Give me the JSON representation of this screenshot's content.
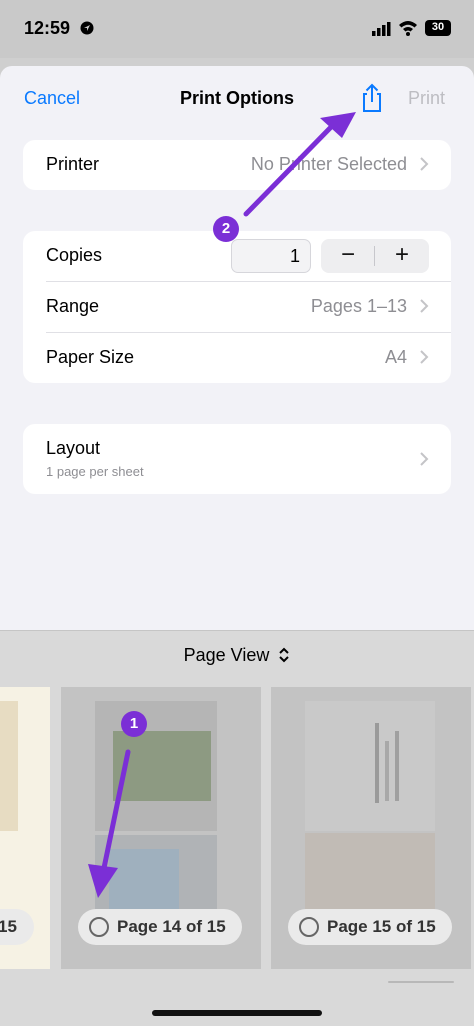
{
  "status": {
    "time": "12:59",
    "battery": "30"
  },
  "nav": {
    "cancel": "Cancel",
    "title": "Print Options",
    "print": "Print",
    "share_icon": "share-icon"
  },
  "printer": {
    "label": "Printer",
    "value": "No Printer Selected"
  },
  "copies": {
    "label": "Copies",
    "value": "1",
    "minus": "−",
    "plus": "+"
  },
  "range": {
    "label": "Range",
    "value": "Pages 1–13"
  },
  "paper": {
    "label": "Paper Size",
    "value": "A4"
  },
  "layout": {
    "label": "Layout",
    "sub": "1 page per sheet"
  },
  "preview": {
    "title": "Page View",
    "pages": [
      {
        "label": "15"
      },
      {
        "label": "Page 14 of 15"
      },
      {
        "label": "Page 15 of 15"
      }
    ]
  },
  "annotations": {
    "badge1": "1",
    "badge2": "2",
    "arrow_color": "#7b2fd6"
  }
}
